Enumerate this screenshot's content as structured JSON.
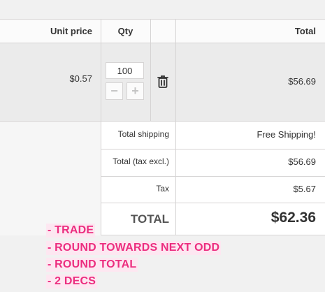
{
  "table": {
    "headers": {
      "unit_price": "Unit price",
      "qty": "Qty",
      "total": "Total"
    },
    "row": {
      "unit_price": "$0.57",
      "qty_value": "100",
      "decrement": "−",
      "increment": "+",
      "total": "$56.69"
    },
    "summary": [
      {
        "label": "Total shipping",
        "value": "Free Shipping!"
      },
      {
        "label": "Total (tax excl.)",
        "value": "$56.69"
      },
      {
        "label": "Tax",
        "value": "$5.67"
      }
    ],
    "grand_total": {
      "label": "TOTAL",
      "value": "$62.36"
    }
  },
  "notes": [
    "- TRADE",
    "- ROUND TOWARDS NEXT ODD",
    "- ROUND TOTAL",
    "- 2 DECS"
  ],
  "colors": {
    "note_text": "#ec2d7f",
    "note_bg": "#fde7f1",
    "border": "#d6d4d4"
  },
  "icons": {
    "delete": "trash-icon"
  }
}
